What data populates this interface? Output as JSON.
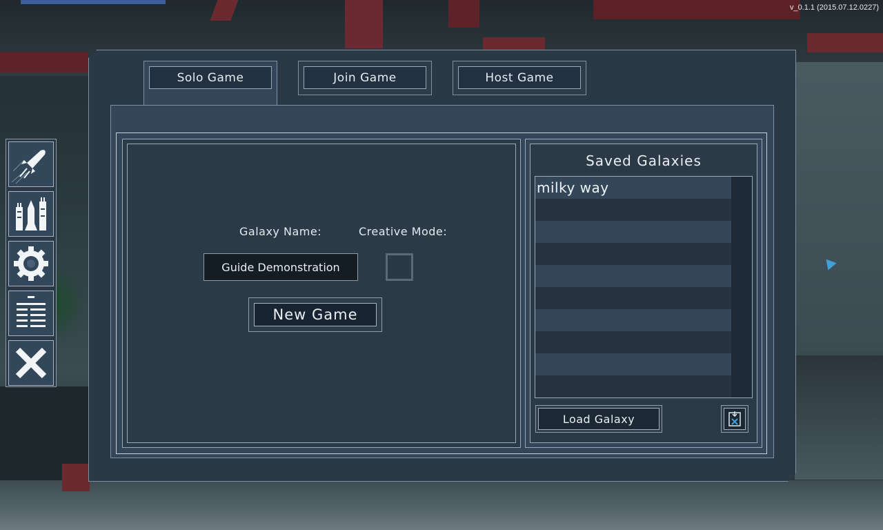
{
  "version": "v_0.1.1 (2015.07.12.0227)",
  "tabs": [
    {
      "label": "Solo Game",
      "active": true
    },
    {
      "label": "Join Game",
      "active": false
    },
    {
      "label": "Host Game",
      "active": false
    }
  ],
  "solo": {
    "galaxy_name_label": "Galaxy Name:",
    "creative_mode_label": "Creative Mode:",
    "galaxy_name_value": "Guide Demonstration",
    "creative_mode_checked": false,
    "new_game_label": "New Game"
  },
  "saved": {
    "title": "Saved Galaxies",
    "items": [
      "milky way",
      "",
      "",
      "",
      "",
      "",
      "",
      "",
      "",
      ""
    ],
    "load_label": "Load Galaxy"
  },
  "sidebar": {
    "items": [
      "rocket-icon",
      "buildings-icon",
      "gear-icon",
      "list-icon",
      "close-icon"
    ]
  },
  "colors": {
    "panel": "#34475a",
    "border": "#9aabb8",
    "text": "#e8eef2",
    "cursor": "#3fa1d8"
  }
}
